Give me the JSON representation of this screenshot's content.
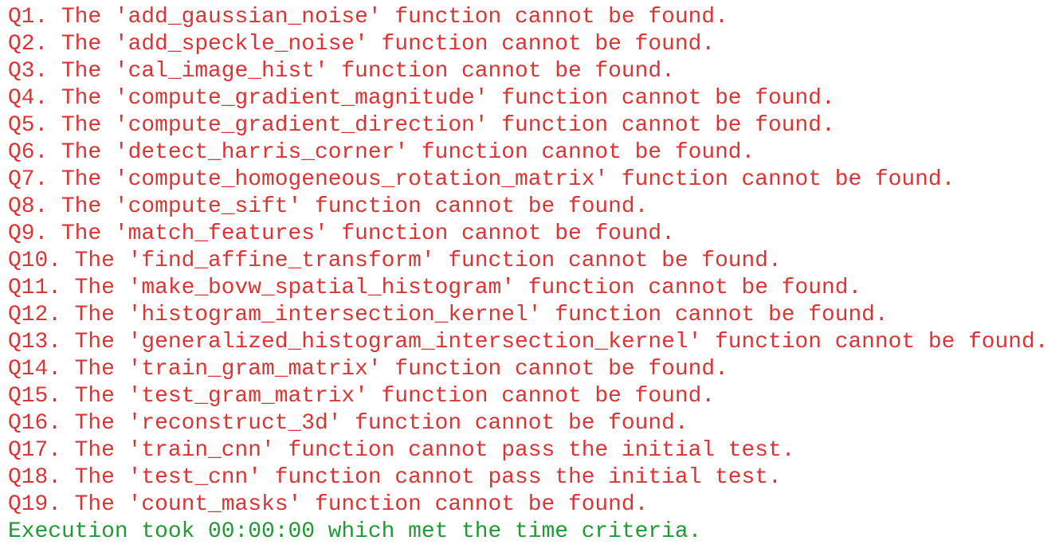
{
  "output": {
    "error_color": "#db3434",
    "success_color": "#1f9a35",
    "lines": [
      "Q1. The 'add_gaussian_noise' function cannot be found.",
      "Q2. The 'add_speckle_noise' function cannot be found.",
      "Q3. The 'cal_image_hist' function cannot be found.",
      "Q4. The 'compute_gradient_magnitude' function cannot be found.",
      "Q5. The 'compute_gradient_direction' function cannot be found.",
      "Q6. The 'detect_harris_corner' function cannot be found.",
      "Q7. The 'compute_homogeneous_rotation_matrix' function cannot be found.",
      "Q8. The 'compute_sift' function cannot be found.",
      "Q9. The 'match_features' function cannot be found.",
      "Q10. The 'find_affine_transform' function cannot be found.",
      "Q11. The 'make_bovw_spatial_histogram' function cannot be found.",
      "Q12. The 'histogram_intersection_kernel' function cannot be found.",
      "Q13. The 'generalized_histogram_intersection_kernel' function cannot be found.",
      "Q14. The 'train_gram_matrix' function cannot be found.",
      "Q15. The 'test_gram_matrix' function cannot be found.",
      "Q16. The 'reconstruct_3d' function cannot be found.",
      "Q17. The 'train_cnn' function cannot pass the initial test.",
      "Q18. The 'test_cnn' function cannot pass the initial test.",
      "Q19. The 'count_masks' function cannot be found."
    ],
    "summary": "Execution took 00:00:00 which met the time criteria."
  }
}
